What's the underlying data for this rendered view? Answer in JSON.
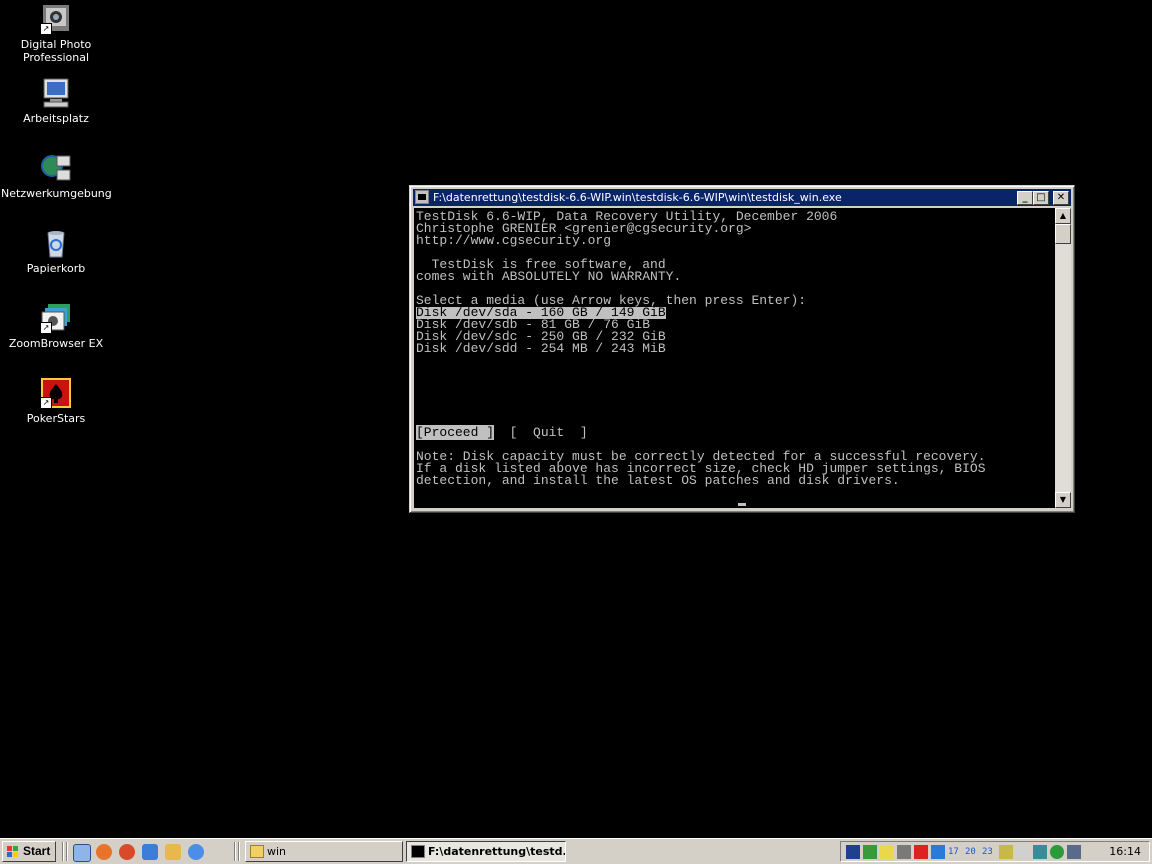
{
  "desktop": {
    "icons": [
      {
        "label": "Digital Photo Professional",
        "icon": "digital-photo-professional-icon"
      },
      {
        "label": "Arbeitsplatz",
        "icon": "my-computer-icon"
      },
      {
        "label": "Netzwerkumgebung",
        "icon": "network-places-icon"
      },
      {
        "label": "Papierkorb",
        "icon": "recycle-bin-icon"
      },
      {
        "label": "ZoomBrowser EX",
        "icon": "zoombrowser-icon"
      },
      {
        "label": "PokerStars",
        "icon": "pokerstars-icon"
      }
    ]
  },
  "console": {
    "title": "F:\\datenrettung\\testdisk-6.6-WIP.win\\testdisk-6.6-WIP\\win\\testdisk_win.exe",
    "lines": {
      "header1": "TestDisk 6.6-WIP, Data Recovery Utility, December 2006",
      "header2": "Christophe GRENIER <grenier@cgsecurity.org>",
      "header3": "http://www.cgsecurity.org",
      "license1": "  TestDisk is free software, and",
      "license2": "comes with ABSOLUTELY NO WARRANTY.",
      "prompt": "Select a media (use Arrow keys, then press Enter):",
      "note1": "Note: Disk capacity must be correctly detected for a successful recovery.",
      "note2": "If a disk listed above has incorrect size, check HD jumper settings, BIOS",
      "note3": "detection, and install the latest OS patches and disk drivers."
    },
    "disks": [
      "Disk /dev/sda - 160 GB / 149 GiB",
      "Disk /dev/sdb - 81 GB / 76 GiB",
      "Disk /dev/sdc - 250 GB / 232 GiB",
      "Disk /dev/sdd - 254 MB / 243 MiB"
    ],
    "selected_disk_index": 0,
    "menu": {
      "proceed": "[Proceed ]",
      "quit": "[  Quit  ]"
    }
  },
  "taskbar": {
    "start_label": "Start",
    "quick_launch": [
      "show-desktop-icon",
      "firefox-icon",
      "browser-icon",
      "network-share-icon",
      "tools-icon",
      "sync-icon"
    ],
    "tasks": [
      {
        "label": "win",
        "active": false
      },
      {
        "label": "F:\\datenrettung\\testd...",
        "active": true
      }
    ],
    "clock": "16:14"
  },
  "colors": {
    "desktop_bg": "#000000",
    "titlebar": "#0a246a",
    "console_text": "#c0c0c0",
    "chrome": "#d4d0c8"
  }
}
